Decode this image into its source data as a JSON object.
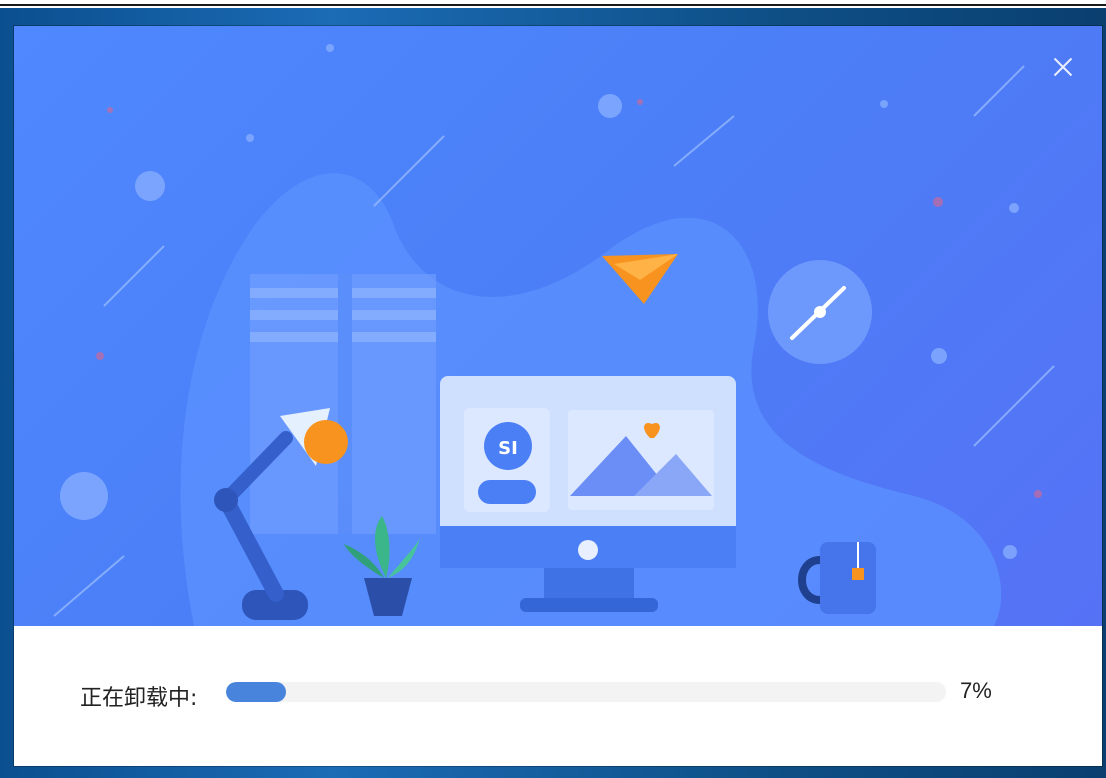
{
  "dialog": {
    "status_label": "正在卸载中:",
    "progress_percent": 7,
    "progress_text": "7%",
    "close_icon": "close-icon"
  },
  "colors": {
    "banner_blue": "#4f88ff",
    "progress_fill": "#4884dc",
    "progress_track": "#f3f3f3",
    "accent_orange": "#f7931e"
  },
  "illustration_icons": [
    "desk-lamp-icon",
    "monitor-icon",
    "paper-plane-icon",
    "clock-icon",
    "plant-icon",
    "mug-icon",
    "bookshelf-icon",
    "social-security-logo"
  ]
}
